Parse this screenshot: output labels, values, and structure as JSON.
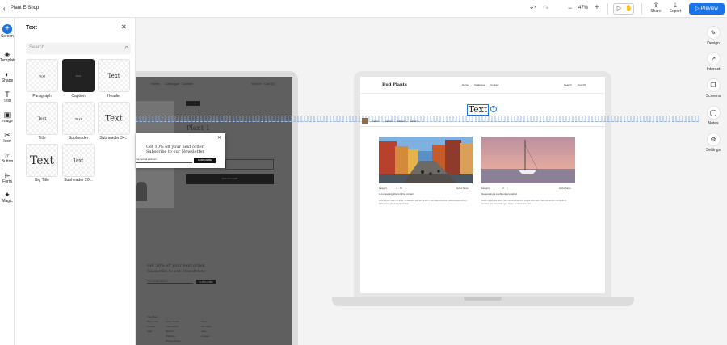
{
  "topbar": {
    "back_icon": "chevron-left-icon",
    "title": "Plant E-Shop",
    "zoom": "47%",
    "share_label": "Share",
    "export_label": "Export",
    "preview_label": "Preview",
    "accent": "#1a73e8"
  },
  "rail": {
    "screen": "Screen",
    "template": "Template",
    "shape": "Shape",
    "text": "Text",
    "image": "Image",
    "icon": "Icon",
    "button": "Button",
    "form": "Form",
    "magic": "Magic"
  },
  "panel": {
    "title": "Text",
    "search_placeholder": "Search",
    "tiles": [
      {
        "preview": "Text",
        "label": "Paragraph"
      },
      {
        "preview": "Text",
        "label": "Caption"
      },
      {
        "preview": "Text",
        "label": "Header"
      },
      {
        "preview": "Text",
        "label": "Title"
      },
      {
        "preview": "Text",
        "label": "Subheader"
      },
      {
        "preview": "Text",
        "label": "Subheader 34..."
      },
      {
        "preview": "Text",
        "label": "Big Title"
      },
      {
        "preview": "Text",
        "label": "Subheader 20..."
      }
    ]
  },
  "dark_screen": {
    "nav": [
      "Home",
      "Catalogue",
      "Contact",
      "Search",
      "Cart (1)"
    ],
    "plant_title": "Plant 1",
    "cart_button": "ADD TO CART",
    "newsletter_line1": "Get 10% off your next order.",
    "newsletter_line2": "Subscribe to our Newsletter",
    "email_placeholder": "Your email address",
    "subscribe": "SUBSCRIBE",
    "footer": [
      "Your Bud",
      "Plant Care",
      "Contact",
      "Help",
      "Order Plants",
      "Track Order",
      "Returns",
      "Shipping",
      "Privacy Policy",
      "Store",
      "Our Story",
      "Jobs",
      "Contact"
    ]
  },
  "popup": {
    "line1": "Get 10% off your next order.",
    "line2": "Subscribe to our Newsletter",
    "email_placeholder": "Your email address",
    "subscribe": "SUBSCRIBE"
  },
  "laptop_screen": {
    "brand": "Bud Plants",
    "nav": [
      "Home",
      "Catalogue",
      "Contact",
      "Search",
      "Cart (0)"
    ],
    "selected_text": "Text",
    "breadcrumbs": [
      "Label",
      "Label 1",
      "Label 2",
      "Label 3"
    ],
    "cards": [
      {
        "category": "Category",
        "stats": "34",
        "author": "Author Name",
        "title": "A compelling title for this content",
        "body": "Lorem ipsum dolor sit amet, consectetur adipiscing elit. In sed diam interdum, pellentesque velit et, finibus orci. Aliquam erat volutpat."
      },
      {
        "category": "Category",
        "stats": "12",
        "author": "Author Name",
        "title": "Generating a confidential product",
        "body": "Fusce sagittis leo lacus. Nam vel condimentum feugiat dolor sem. Sed elementum nisl ligula, ut tincidunt nisl accumsan eget. Donec et elementum nisl."
      }
    ]
  },
  "right_rail": {
    "design": "Design",
    "interact": "Interact",
    "screens": "Screens",
    "notes": "Notes",
    "settings": "Settings"
  }
}
